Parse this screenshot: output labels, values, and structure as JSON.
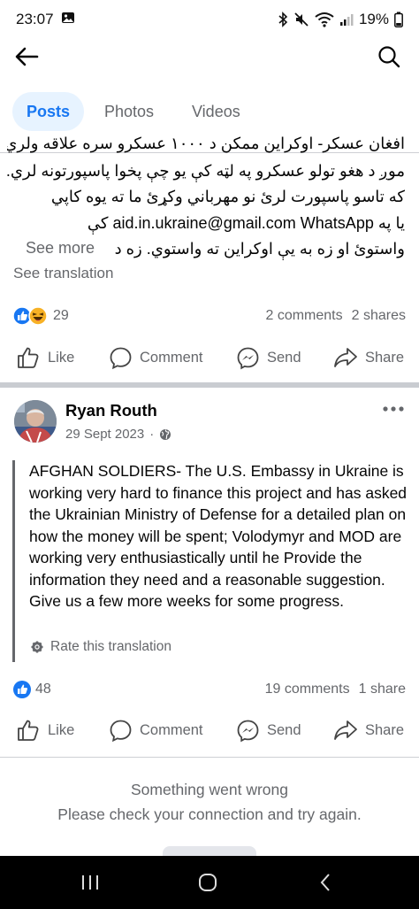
{
  "status_bar": {
    "time": "23:07",
    "battery": "19%"
  },
  "tabs": [
    {
      "label": "Posts",
      "active": true
    },
    {
      "label": "Photos",
      "active": false
    },
    {
      "label": "Videos",
      "active": false
    }
  ],
  "post1": {
    "rtl_lines": [
      "افغان عسکر- اوکراین ممکن د ۱۰۰۰ عسکرو سره علاقه ولري، او",
      "موږ د هغو تولو عسکرو په لټه کې یو چې پخوا پاسپورتونه لري.",
      "که تاسو پاسپورت لرئ نو مهرباني وکړئ ما ته یوه کاپي",
      "یا په aid.in.ukraine@gmail.com WhatsApp کې",
      "واستوئ او زه به یې اوکراین ته واستوي.  زه دا ..."
    ],
    "see_more": "See more",
    "see_translation": "See translation",
    "reaction_count": "29",
    "comments": "2 comments",
    "shares": "2 shares"
  },
  "actions": {
    "like": "Like",
    "comment": "Comment",
    "send": "Send",
    "share": "Share"
  },
  "post2": {
    "author": "Ryan Routh",
    "date": "29 Sept 2023",
    "separator": "·",
    "text": "AFGHAN SOLDIERS- The U.S. Embassy in Ukraine is working very hard to finance this project and has asked the Ukrainian Ministry of Defense for a detailed plan on how the money will be spent; Volodymyr and MOD are working very enthusiastically until he Provide the information they need and a reasonable suggestion. Give us a few more weeks for some progress.",
    "rate_translation": "Rate this translation",
    "reaction_count": "48",
    "comments": "19 comments",
    "shares": "1 share"
  },
  "error": {
    "title": "Something went wrong",
    "message": "Please check your connection and try again."
  },
  "icons": {
    "back": "arrow-left-icon",
    "search": "search-icon",
    "like": "thumbs-up-icon",
    "comment": "comment-bubble-icon",
    "send": "messenger-icon",
    "share": "share-arrow-icon",
    "more": "more-dots-icon",
    "globe": "globe-icon",
    "gear": "gear-icon"
  },
  "colors": {
    "accent": "#1877f2",
    "tab_active_bg": "#e7f3ff",
    "muted": "#65676b"
  }
}
